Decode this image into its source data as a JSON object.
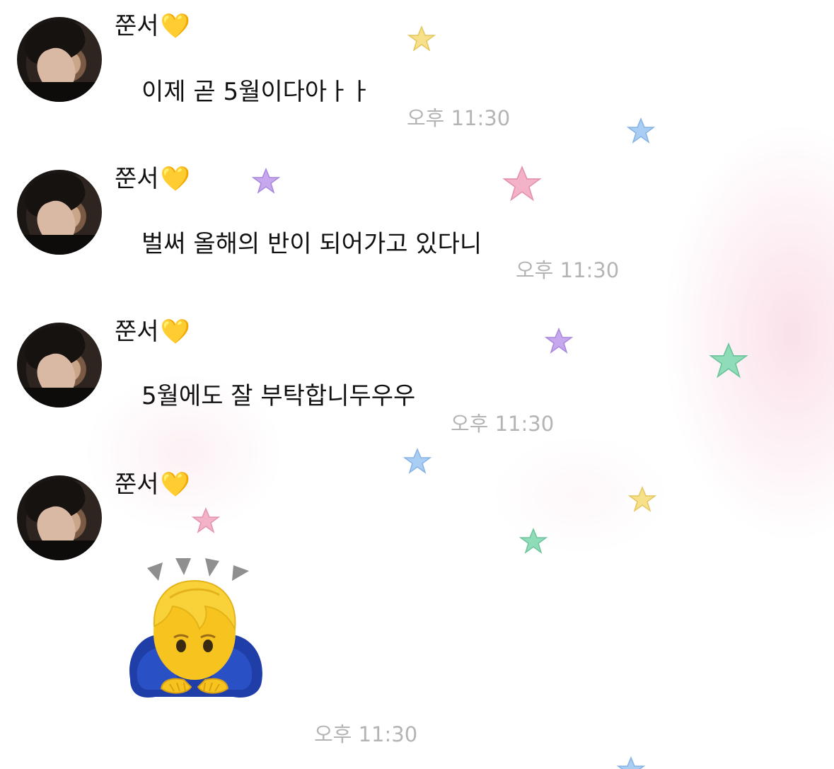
{
  "colors": {
    "time": "#b4b4b4",
    "text": "#111111",
    "heart": "#f5c21b",
    "background_blush": "#f7c8d7"
  },
  "messages": [
    {
      "sender": "쭌서",
      "heart": "💛",
      "text": "이제 곧 5월이다아ㅏㅏ",
      "time": "오후 11:30"
    },
    {
      "sender": "쭌서",
      "heart": "💛",
      "text": "벌써 올해의 반이 되어가고 있다니",
      "time": "오후 11:30"
    },
    {
      "sender": "쭌서",
      "heart": "💛",
      "text": "5월에도 잘 부탁합니두우우",
      "time": "오후 11:30"
    },
    {
      "sender": "쭌서",
      "heart": "💛",
      "emoji": "person-bowing-emoji",
      "time": "오후 11:30"
    }
  ],
  "stars": [
    {
      "color": "#f6e08a",
      "icon": "star-icon"
    },
    {
      "color": "#a9cdf3",
      "icon": "star-icon"
    },
    {
      "color": "#c7a7ee",
      "icon": "star-icon"
    },
    {
      "color": "#f4b2c8",
      "icon": "star-icon"
    },
    {
      "color": "#c7a7ee",
      "icon": "star-icon"
    },
    {
      "color": "#8fdcb8",
      "icon": "star-icon"
    },
    {
      "color": "#a9cdf3",
      "icon": "star-icon"
    },
    {
      "color": "#f6e08a",
      "icon": "star-icon"
    },
    {
      "color": "#8fdcb8",
      "icon": "star-icon"
    },
    {
      "color": "#f4b2c8",
      "icon": "star-icon"
    },
    {
      "color": "#a9cdf3",
      "icon": "star-icon"
    }
  ]
}
